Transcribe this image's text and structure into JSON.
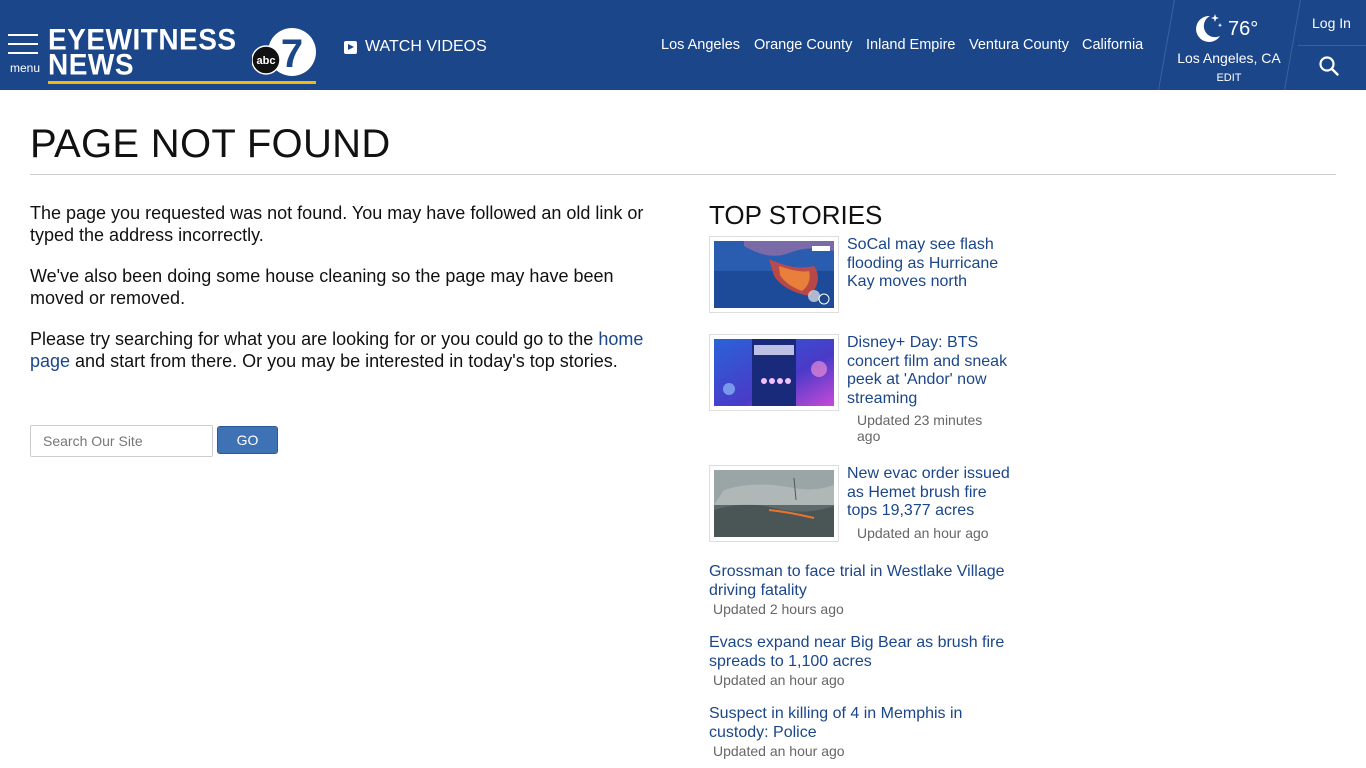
{
  "header": {
    "menu_label": "menu",
    "logo_line1": "EYEWITNESS",
    "logo_line2": "NEWS",
    "logo_badge": "abc",
    "logo_number": "7",
    "watch_label": "WATCH VIDEOS",
    "nav": [
      "Los Angeles",
      "Orange County",
      "Inland Empire",
      "Ventura County",
      "California"
    ],
    "weather": {
      "temp": "76°",
      "city": "Los Angeles, CA",
      "edit": "EDIT"
    },
    "login": "Log In",
    "colors": {
      "bar": "#1b4689",
      "accent": "#f5b90d"
    }
  },
  "main": {
    "title": "PAGE NOT FOUND",
    "para1": "The page you requested was not found. You may have followed an old link or typed the address incorrectly.",
    "para2": "We've also been doing some house cleaning so the page may have been moved or removed.",
    "para3_before": "Please try searching for what you are looking for or you could go to the ",
    "para3_link": "home page",
    "para3_after": " and start from there. Or you may be interested in today's top stories.",
    "search_placeholder": "Search Our Site",
    "go_label": "GO"
  },
  "top_stories": {
    "title": "TOP STORIES",
    "cards": [
      {
        "headline": "SoCal may see flash flooding as Hurricane Kay moves north",
        "updated": ""
      },
      {
        "headline": "Disney+ Day: BTS concert film and sneak peek at 'Andor' now streaming",
        "updated": "Updated 23 minutes ago"
      },
      {
        "headline": "New evac order issued as Hemet brush fire tops 19,377 acres",
        "updated": "Updated an hour ago"
      }
    ],
    "list": [
      {
        "headline": "Grossman to face trial in Westlake Village driving fatality",
        "updated": "Updated 2 hours ago"
      },
      {
        "headline": "Evacs expand near Big Bear as brush fire spreads to 1,100 acres",
        "updated": "Updated an hour ago"
      },
      {
        "headline": "Suspect in killing of 4 in Memphis in custody: Police",
        "updated": "Updated an hour ago"
      }
    ]
  }
}
